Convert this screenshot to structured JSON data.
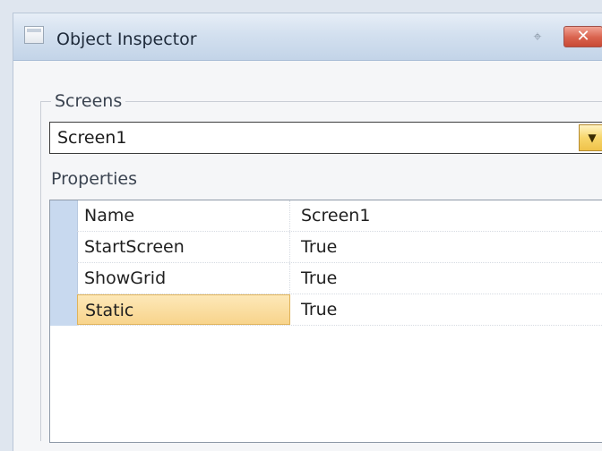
{
  "window": {
    "title": "Object Inspector",
    "icons": {
      "app": "window-icon",
      "pin": "pin-icon",
      "close": "close-icon"
    }
  },
  "screens": {
    "label": "Screens",
    "selected": "Screen1"
  },
  "properties": {
    "label": "Properties",
    "rows": [
      {
        "name": "Name",
        "value": "Screen1"
      },
      {
        "name": "StartScreen",
        "value": "True"
      },
      {
        "name": "ShowGrid",
        "value": "True"
      },
      {
        "name": "Static",
        "value": "True",
        "selected": true
      }
    ]
  },
  "colors": {
    "accent": "#c8d9ef",
    "selected_row": "#f8d48c",
    "close_button": "#d9624d"
  }
}
